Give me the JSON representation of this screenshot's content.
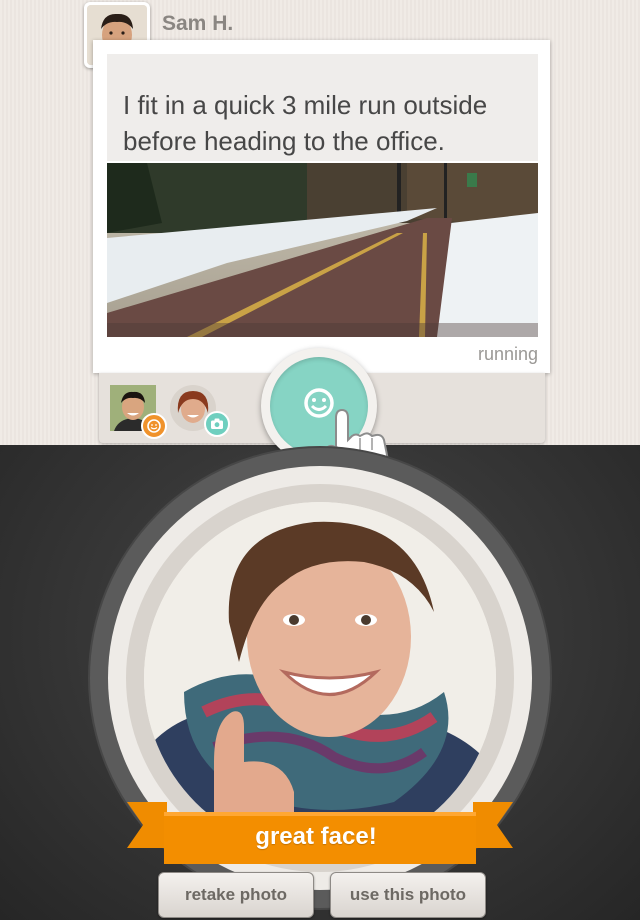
{
  "post": {
    "author": "Sam H.",
    "text": "I fit in a quick 3 mile run outside before heading to the office.",
    "tag": "running"
  },
  "reactions": {
    "items": [
      {
        "type": "smile",
        "badge_color": "#f0922b",
        "badge_icon": "smile-icon"
      },
      {
        "type": "photo",
        "badge_color": "#6fcfbf",
        "badge_icon": "camera-icon"
      }
    ]
  },
  "capture": {
    "ribbon_label": "great face!",
    "retake_label": "retake photo",
    "use_label": "use this photo"
  },
  "colors": {
    "accent_teal": "#86d4c4",
    "ribbon_orange": "#f08c00",
    "dark_bg": "#333333"
  }
}
